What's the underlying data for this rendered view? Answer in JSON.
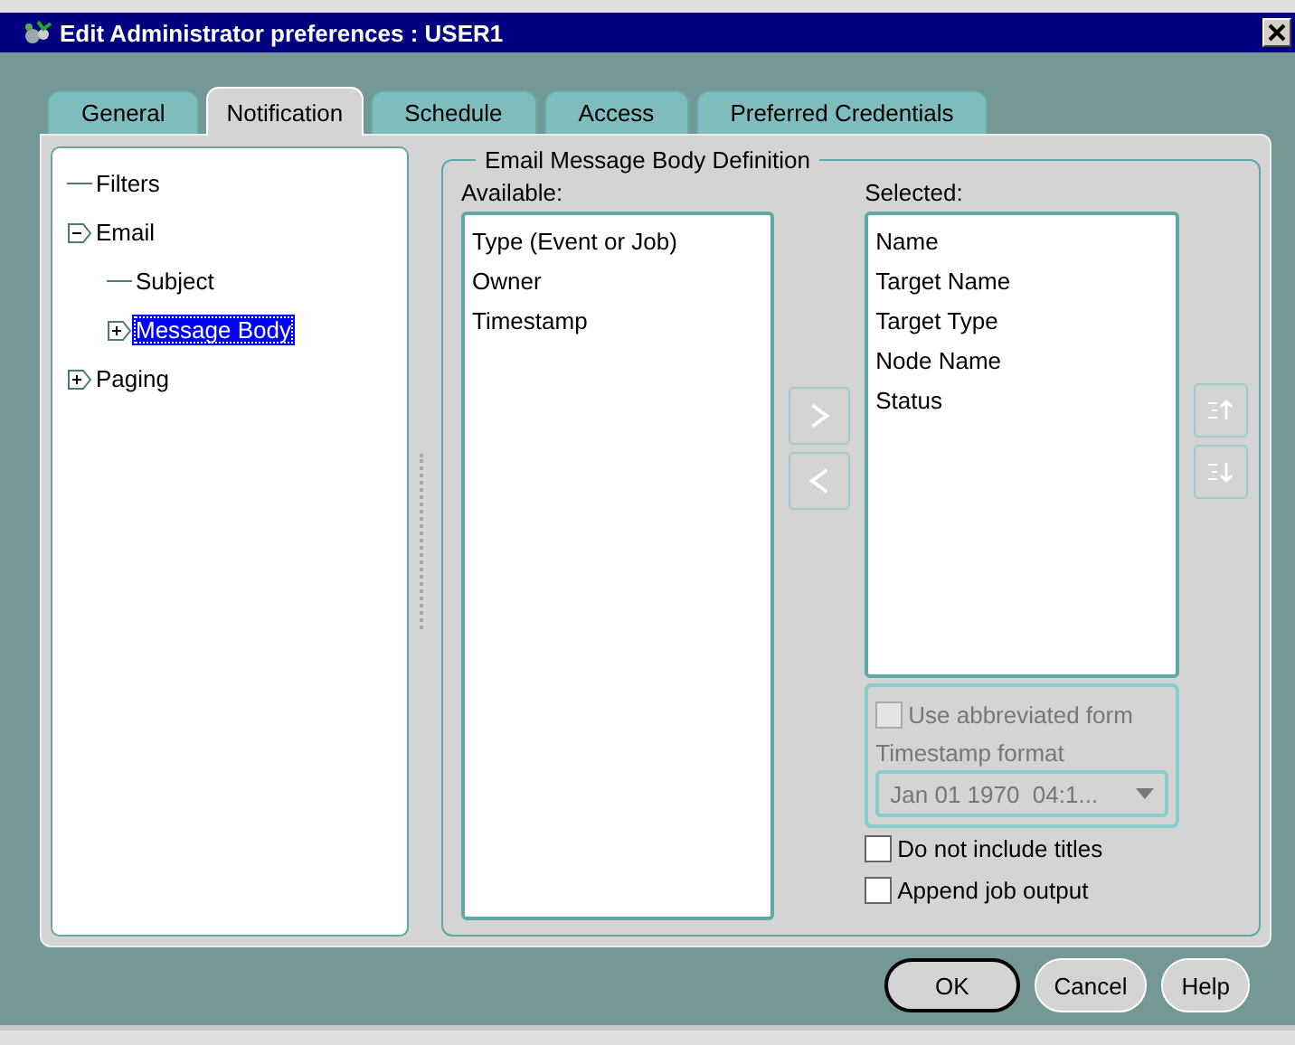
{
  "window": {
    "title": "Edit Administrator preferences : USER1"
  },
  "tabs": [
    {
      "label": "General",
      "selected": false
    },
    {
      "label": "Notification",
      "selected": true
    },
    {
      "label": "Schedule",
      "selected": false
    },
    {
      "label": "Access",
      "selected": false
    },
    {
      "label": "Preferred Credentials",
      "selected": false
    }
  ],
  "tree": [
    {
      "label": "Filters",
      "selected": false
    },
    {
      "label": "Email",
      "selected": false,
      "expanded": true,
      "children": [
        {
          "label": "Subject",
          "selected": false
        },
        {
          "label": "Message Body",
          "selected": true,
          "expanded": false
        }
      ]
    },
    {
      "label": "Paging",
      "selected": false,
      "expanded": false
    }
  ],
  "group": {
    "title": "Email Message Body Definition",
    "available": {
      "label": "Available:",
      "items": [
        "Type (Event or Job)",
        "Owner",
        "Timestamp"
      ]
    },
    "move_buttons": [
      {
        "kind": "add",
        "disabled": true
      },
      {
        "kind": "remove",
        "disabled": true
      }
    ],
    "selected_list": {
      "label": "Selected:",
      "items": [
        "Name",
        "Target Name",
        "Target Type",
        "Node Name",
        "Status"
      ]
    },
    "order_buttons": [
      {
        "kind": "up",
        "disabled": true
      },
      {
        "kind": "down",
        "disabled": true
      }
    ],
    "abbreviated": {
      "label": "Use abbreviated form",
      "checked": false,
      "disabled": true
    },
    "timestamp_format": {
      "label": "Timestamp format",
      "value": "Jan 01 1970  04:1...",
      "disabled": true
    },
    "options": [
      {
        "label": "Do not include titles",
        "checked": false
      },
      {
        "label": "Append job output",
        "checked": false
      }
    ]
  },
  "buttons": [
    {
      "label": "OK",
      "default": true
    },
    {
      "label": "Cancel",
      "default": false
    },
    {
      "label": "Help",
      "default": false
    }
  ]
}
